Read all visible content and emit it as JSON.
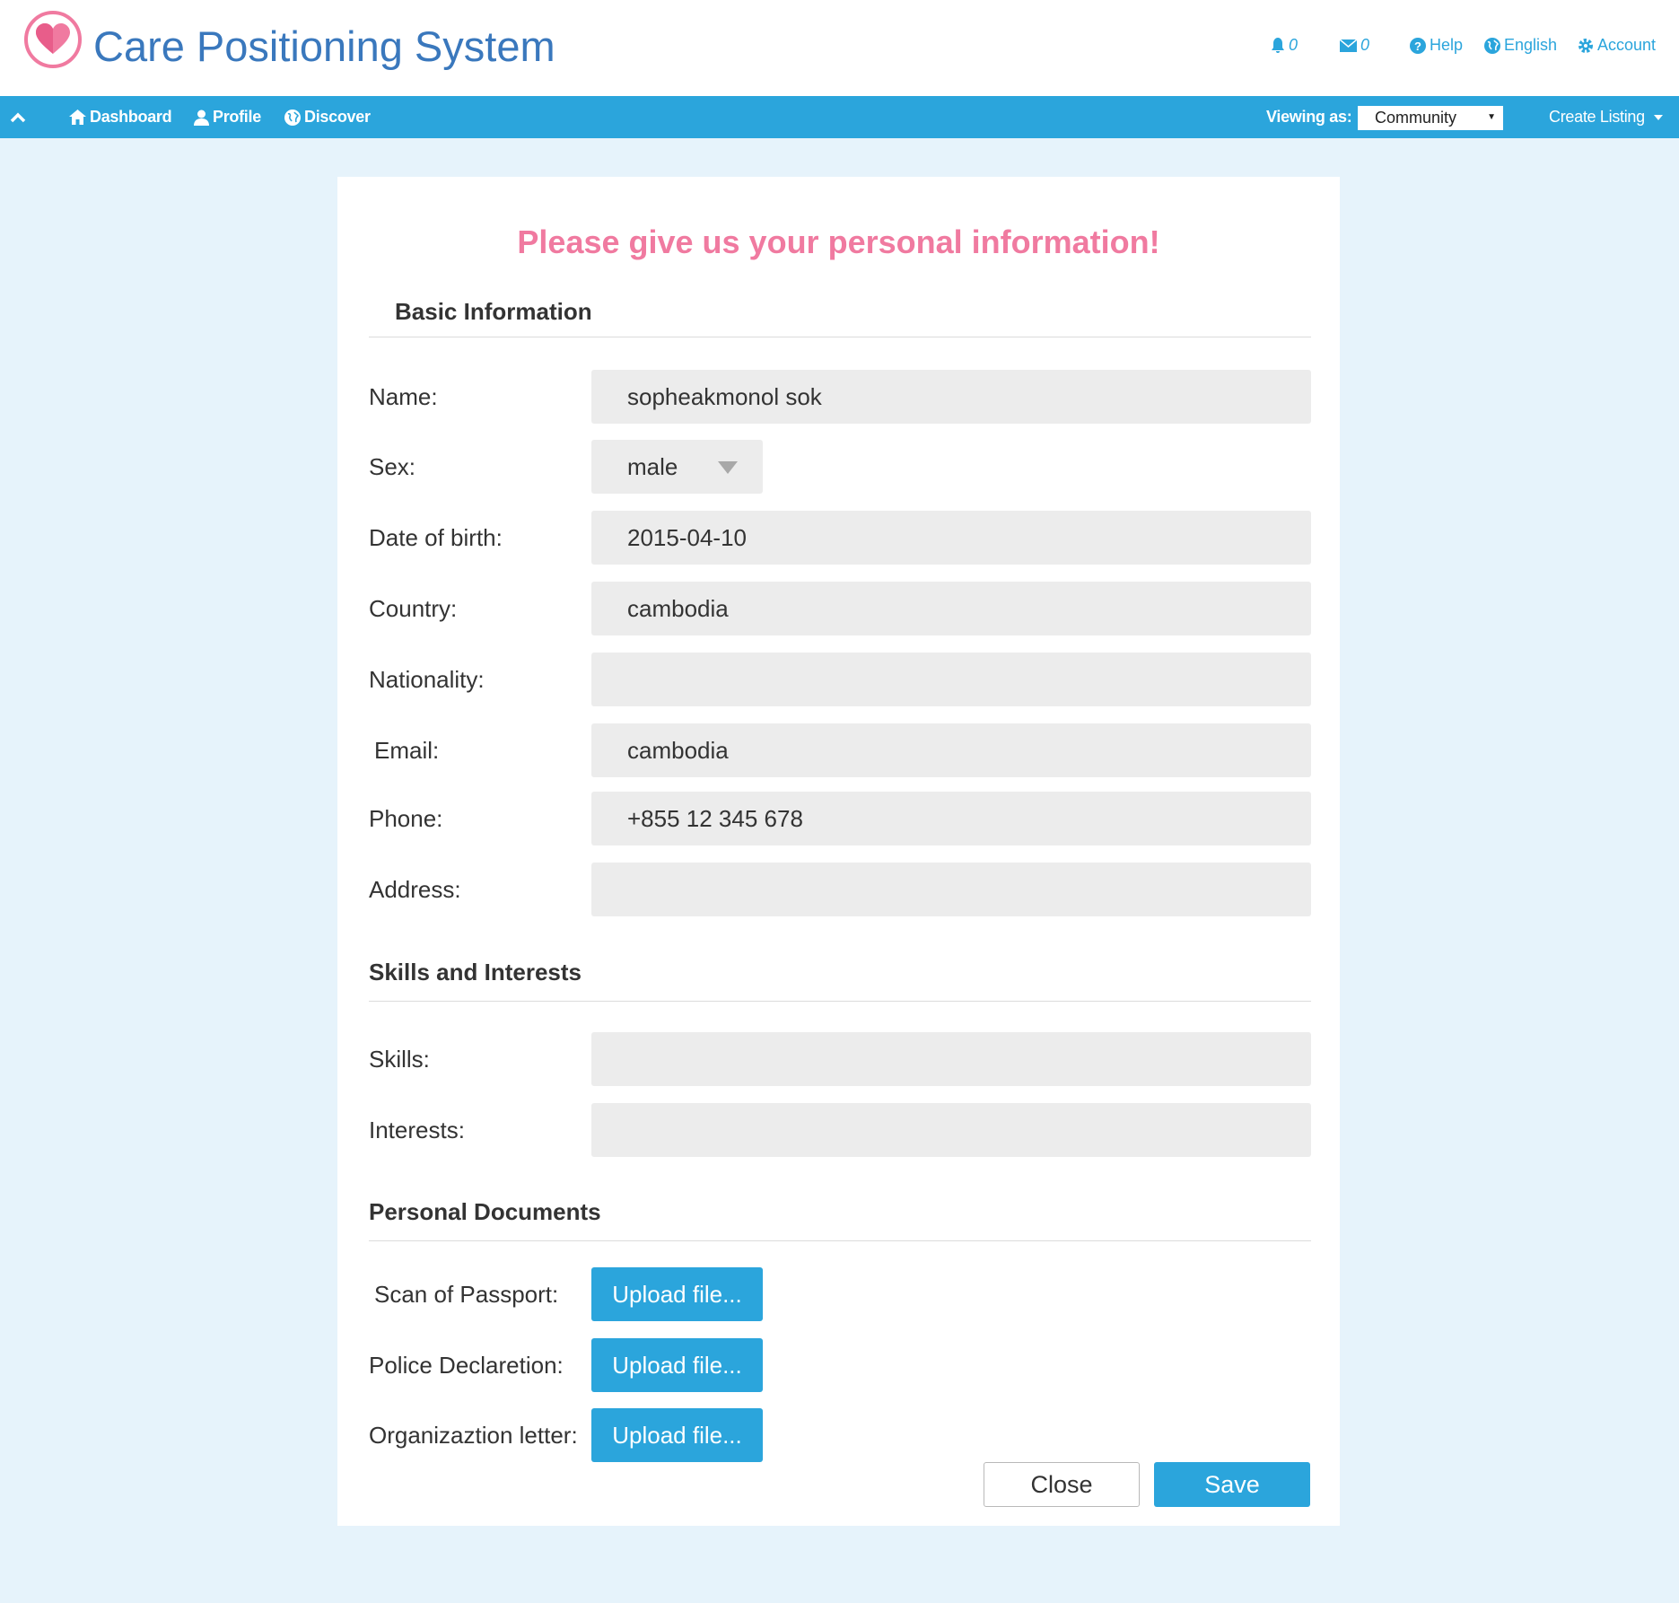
{
  "header": {
    "brand": "Care Positioning System",
    "notifications_count": "0",
    "messages_count": "0",
    "help_label": "Help",
    "language_label": "English",
    "account_label": "Account"
  },
  "navbar": {
    "dashboard_label": "Dashboard",
    "profile_label": "Profile",
    "discover_label": "Discover",
    "viewing_as_label": "Viewing as:",
    "viewing_as_value": "Community",
    "create_listing_label": "Create Listing"
  },
  "form": {
    "title": "Please give us your personal information!",
    "basic_section": "Basic Information",
    "fields": {
      "name": {
        "label": "Name:",
        "value": "sopheakmonol sok"
      },
      "sex": {
        "label": "Sex:",
        "value": "male"
      },
      "dob": {
        "label": "Date of birth:",
        "value": "2015-04-10"
      },
      "country": {
        "label": "Country:",
        "value": "cambodia"
      },
      "nationality": {
        "label": "Nationality:",
        "value": ""
      },
      "email": {
        "label": "Email:",
        "value": "cambodia"
      },
      "phone": {
        "label": "Phone:",
        "value": "+855 12 345 678"
      },
      "address": {
        "label": "Address:",
        "value": ""
      },
      "skills": {
        "label": "Skills:",
        "value": ""
      },
      "interests": {
        "label": "Interests:",
        "value": ""
      }
    },
    "skills_section": "Skills and Interests",
    "documents_section": "Personal Documents",
    "documents": {
      "passport_label": "Scan of Passport:",
      "police_label": "Police Declaretion:",
      "org_label": "Organizaztion letter:",
      "upload_label": "Upload file..."
    },
    "close_label": "Close",
    "save_label": "Save"
  },
  "colors": {
    "accent": "#2ba5dc",
    "brand_text": "#3a78bd",
    "title_pink": "#f07aa0",
    "background": "#e6f3fb"
  }
}
